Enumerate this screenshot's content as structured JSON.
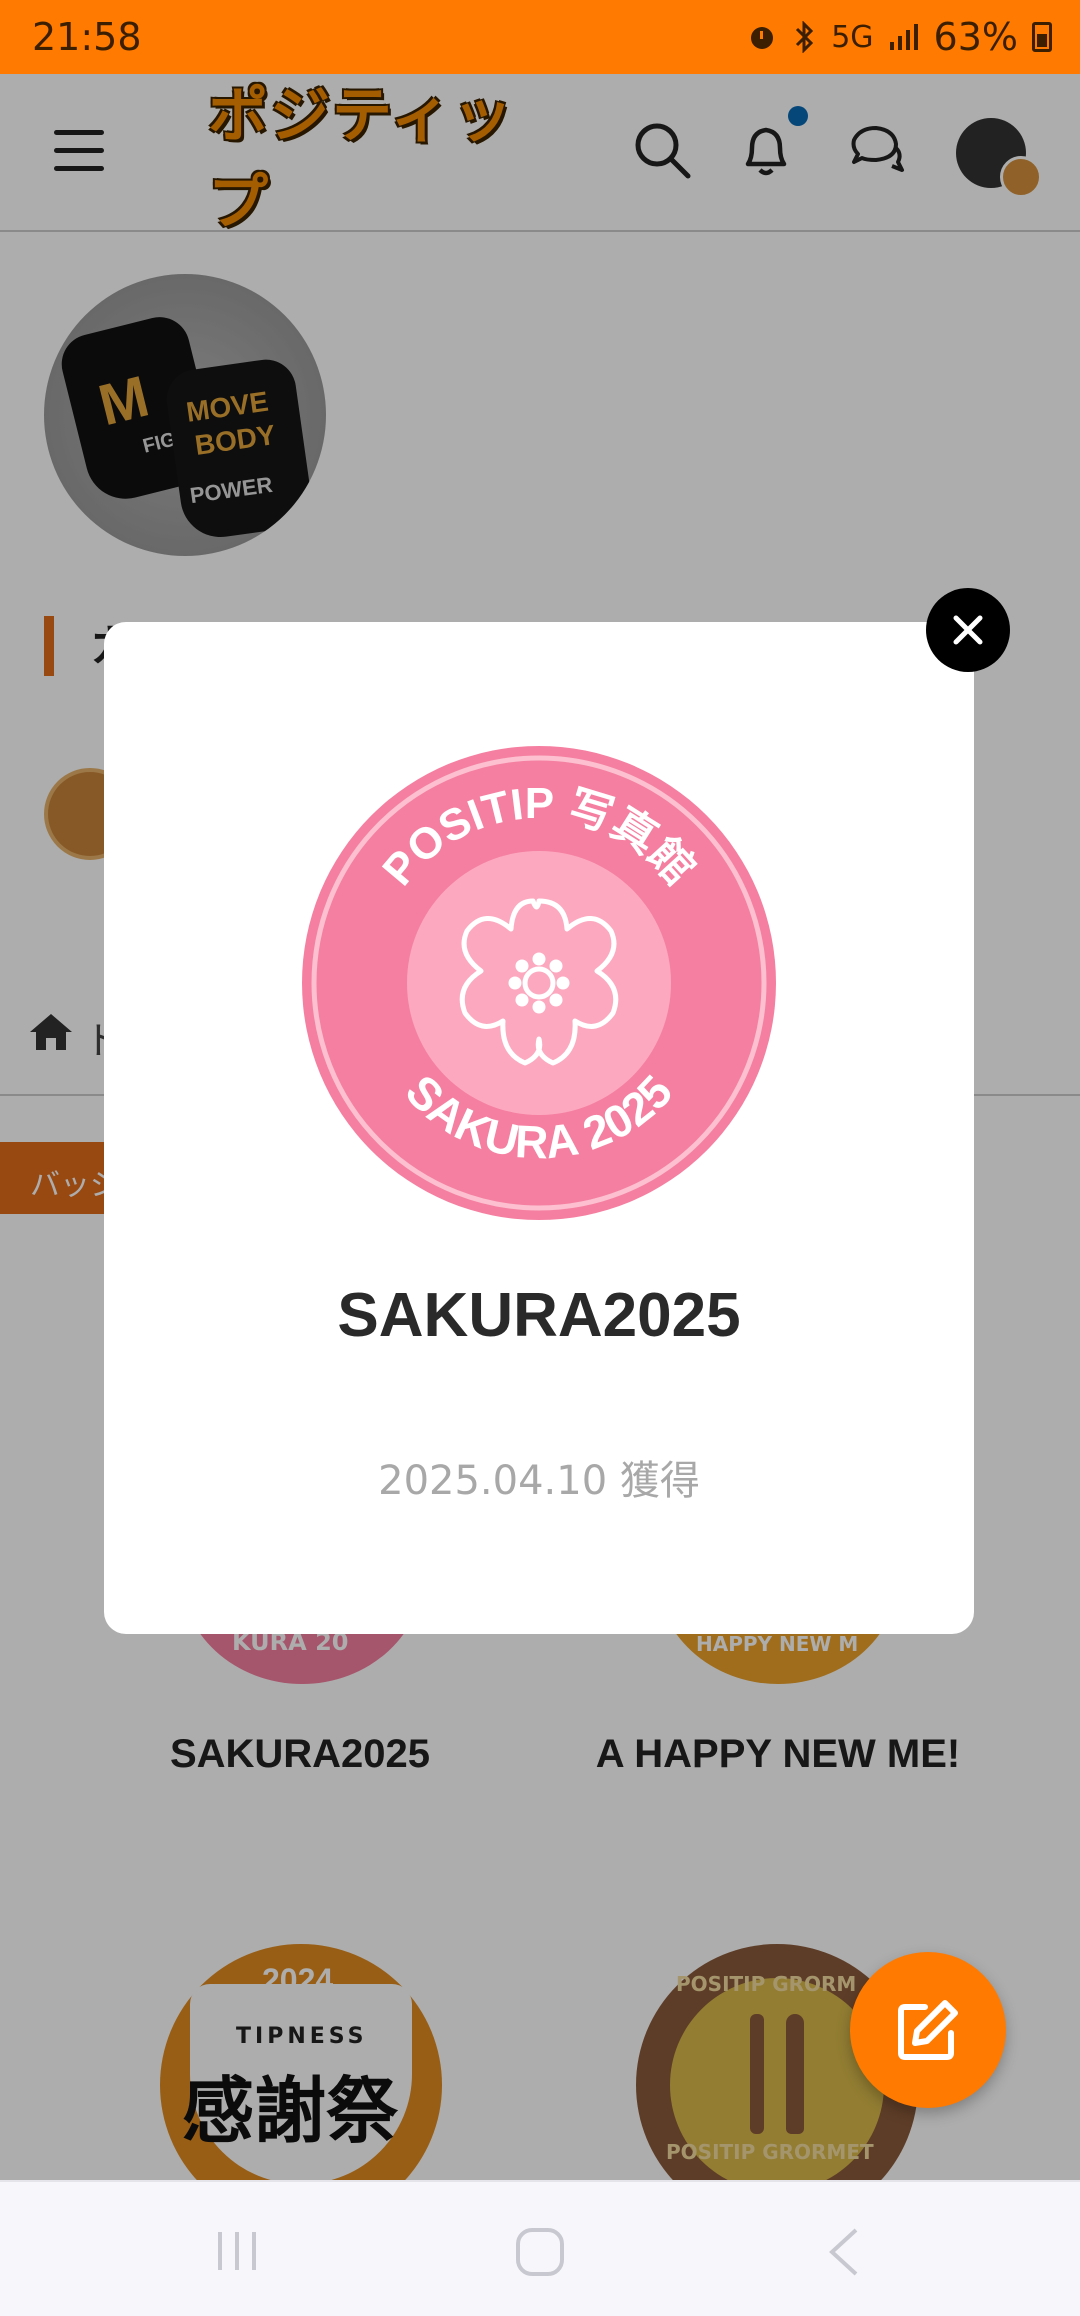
{
  "status_bar": {
    "time": "21:58",
    "network": "5G",
    "battery": "63%",
    "icons": [
      "alarm-icon",
      "bluetooth-icon",
      "signal-icon",
      "battery-icon"
    ]
  },
  "header": {
    "logo_text": "ポジティップ",
    "icons": [
      "menu-icon",
      "search-icon",
      "bell-icon",
      "chat-icon",
      "avatar"
    ]
  },
  "profile": {
    "glove_text_1": "M",
    "glove_text_2": "FIGHT",
    "glove_text_3": "MOVE",
    "glove_text_4": "BODY",
    "glove_text_5": "POWER",
    "name_partial": "カ",
    "home_label": "ト",
    "badge_tab_label": "バッジ"
  },
  "badge_grid": [
    {
      "title": "SAKURA2025",
      "arc_text": "KURA 20"
    },
    {
      "title": "A HAPPY NEW ME!",
      "arc_text": "HAPPY NEW M"
    },
    {
      "title": "",
      "year": "2024",
      "brand": "TIPNESS",
      "kanji": "感謝祭"
    },
    {
      "title": "",
      "top_arc": "POSITIP GRORM",
      "bottom_arc": "POSITIP GRORMET"
    }
  ],
  "modal": {
    "badge_top_text": "POSITIP 写真館",
    "badge_bottom_text": "SAKURA 2025",
    "title": "SAKURA2025",
    "date": "2025.04.10 獲得",
    "colors": {
      "badge_outer": "#f57fa0",
      "badge_inner": "#fca9c0"
    }
  },
  "fab": {
    "icon": "edit-icon"
  },
  "nav_bar": {
    "icons": [
      "recent-apps-icon",
      "home-button-icon",
      "back-icon"
    ]
  }
}
